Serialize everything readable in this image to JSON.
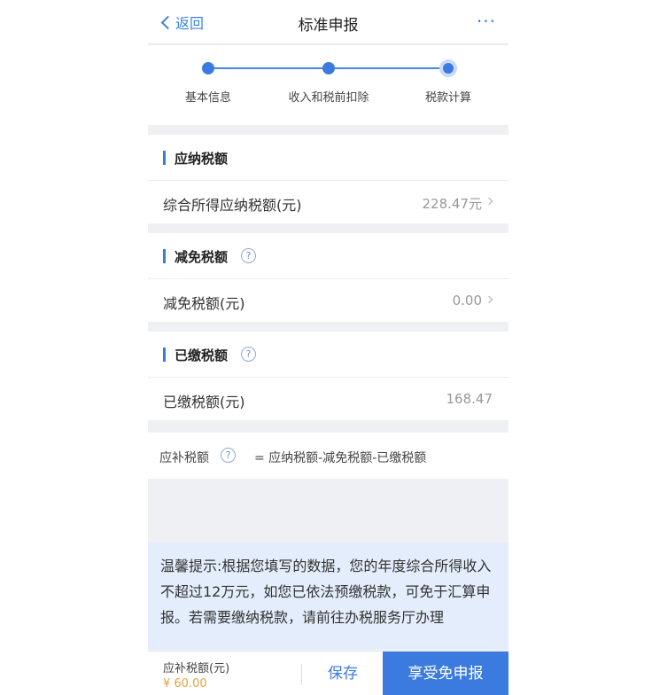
{
  "nav": {
    "back_label": "返回",
    "title": "标准申报",
    "more": "···"
  },
  "steps": [
    {
      "label": "基本信息"
    },
    {
      "label": "收入和税前扣除"
    },
    {
      "label": "税款计算"
    }
  ],
  "sections": {
    "payable": {
      "title": "应纳税额",
      "row_label": "综合所得应纳税额(元)",
      "row_value": "228.47元"
    },
    "reduction": {
      "title": "减免税额",
      "row_label": "减免税额(元)",
      "row_value": "0.00"
    },
    "paid": {
      "title": "已缴税额",
      "row_label": "已缴税额(元)",
      "row_value": "168.47"
    }
  },
  "formula": {
    "left": "应补税额",
    "right": "= 应纳税额-减免税额-已缴税额"
  },
  "tip": {
    "text": "温馨提示:根据您填写的数据，您的年度综合所得收入不超过12万元，如您已依法预缴税款，可免于汇算申报。若需要缴纳税款，请前往办税服务厅办理"
  },
  "bottom": {
    "owe_label": "应补税额(元)",
    "owe_value": "¥ 60.00",
    "save_label": "保存",
    "enjoy_label": "享受免申报"
  },
  "colors": {
    "accent": "#3b7be0",
    "amount": "#e6a23c"
  }
}
